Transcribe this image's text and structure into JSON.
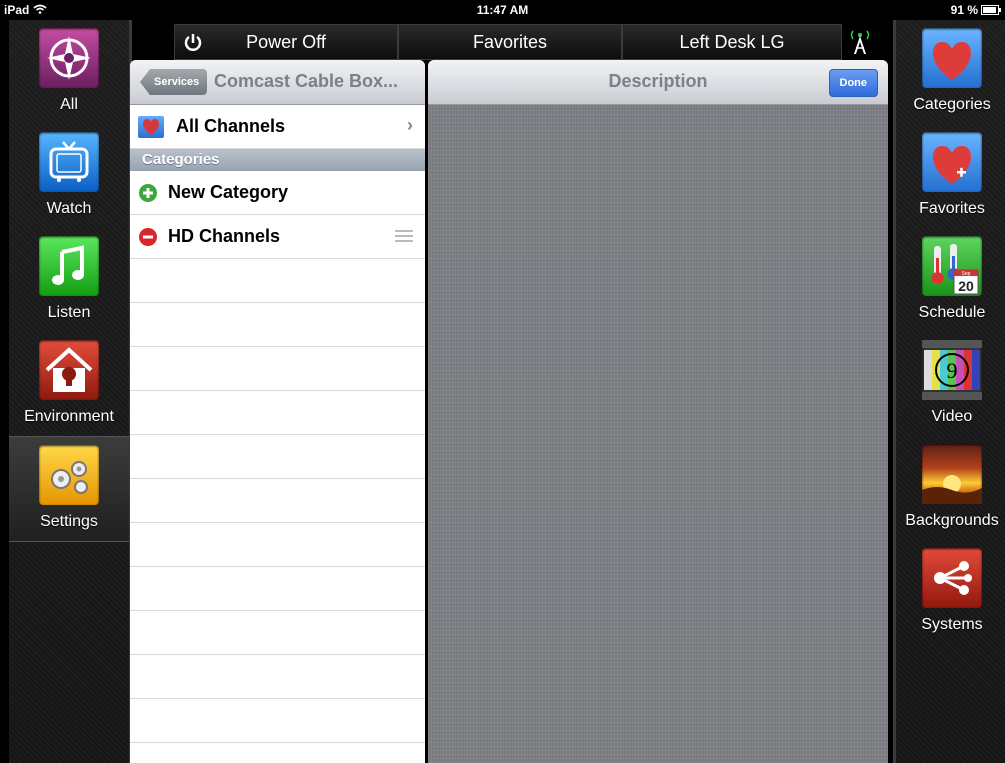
{
  "status_bar": {
    "device": "iPad",
    "time": "11:47 AM",
    "battery": "91 %",
    "battery_level": 0.91
  },
  "toolbar": {
    "power_label": "Power Off",
    "favorites_label": "Favorites",
    "room_label": "Left Desk LG"
  },
  "left_nav": [
    {
      "label": "All",
      "icon": "compass-icon"
    },
    {
      "label": "Watch",
      "icon": "tv-icon"
    },
    {
      "label": "Listen",
      "icon": "music-note-icon"
    },
    {
      "label": "Environment",
      "icon": "house-bulb-icon"
    },
    {
      "label": "Settings",
      "icon": "gears-icon",
      "active": true
    }
  ],
  "right_nav": [
    {
      "label": "Categories",
      "icon": "heart-icon"
    },
    {
      "label": "Favorites",
      "icon": "heart-plus-icon"
    },
    {
      "label": "Schedule",
      "icon": "thermometer-calendar-icon"
    },
    {
      "label": "Video",
      "icon": "film-countdown-icon"
    },
    {
      "label": "Backgrounds",
      "icon": "sunset-icon"
    },
    {
      "label": "Systems",
      "icon": "share-network-icon"
    }
  ],
  "master": {
    "back_label": "Services",
    "title": "Comcast Cable Box...",
    "all_channels": "All Channels",
    "section": "Categories",
    "new_category": "New Category",
    "hd_channels": "HD Channels"
  },
  "detail": {
    "title": "Description",
    "done_label": "Done"
  },
  "icons": {
    "calendar_month": "Sep",
    "calendar_day": "20",
    "countdown_number": "9"
  }
}
